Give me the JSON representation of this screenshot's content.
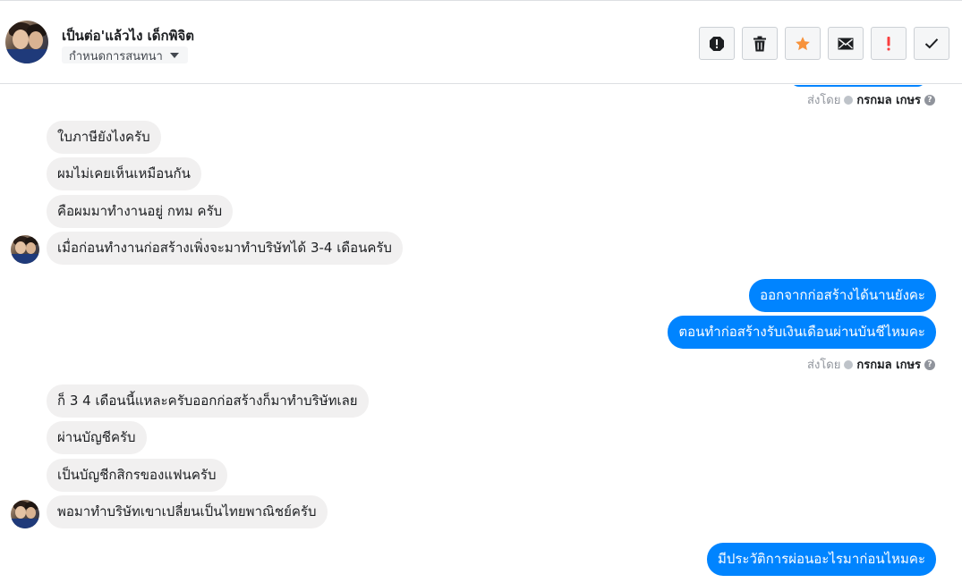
{
  "header": {
    "title": "เป็นต่อ'แล้วไง เด็กพิจิต",
    "subtitle": "กำหนดการสนทนา",
    "actions": [
      {
        "icon": "report-icon"
      },
      {
        "icon": "trash-icon"
      },
      {
        "icon": "star-icon",
        "color": "#f7923b"
      },
      {
        "icon": "envelope-icon"
      },
      {
        "icon": "important-icon",
        "color": "#fa3e3e"
      },
      {
        "icon": "check-icon"
      }
    ]
  },
  "sent_by": {
    "prefix": "ส่งโดย",
    "name": "กรกมล เกษร"
  },
  "messages": {
    "m1": "ใบภาษียังไงครับ",
    "m2": "ผมไม่เคยเห็นเหมือนกัน",
    "m3": "คือผมมาทำงานอยู่ กทม ครับ",
    "m4": "เมื่อก่อนทำงานก่อสร้างเพิ่งจะมาทำบริษัทได้ 3-4 เดือนครับ",
    "m5": "ออกจากก่อสร้างได้นานยังคะ",
    "m6": "ตอนทำก่อสร้างรับเงินเดือนผ่านบันชีไหมคะ",
    "m7": "ก็ 3 4 เดือนนี้แหละครับออกก่อสร้างก็มาทำบริษัทเลย",
    "m8": "ผ่านบัญชีครับ",
    "m9": "เป็นบัญชีกสิกรของแฟนครับ",
    "m10": "พอมาทำบริษัทเขาเปลี่ยนเป็นไทยพาณิชย์ครับ",
    "m11": "มีประวัติการผ่อนอะไรมาก่อนไหมคะ"
  },
  "colors": {
    "outgoing": "#0084ff",
    "incoming": "#f1f0f0"
  }
}
